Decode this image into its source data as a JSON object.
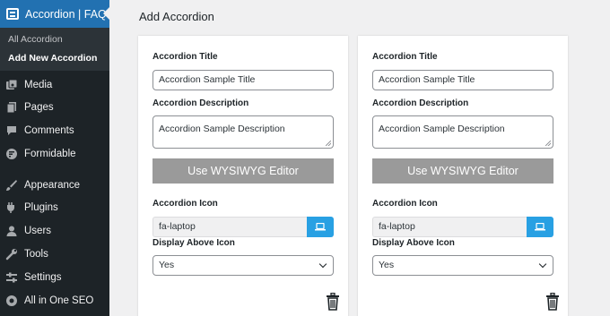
{
  "sidebar": {
    "active_menu": "Accordion | FAQ",
    "submenu": [
      {
        "label": "All Accordion"
      },
      {
        "label": "Add New Accordion"
      }
    ],
    "items": [
      {
        "label": "Media",
        "icon": "media-icon"
      },
      {
        "label": "Pages",
        "icon": "pages-icon"
      },
      {
        "label": "Comments",
        "icon": "comments-icon"
      },
      {
        "label": "Formidable",
        "icon": "formidable-icon"
      },
      {
        "label": "Appearance",
        "icon": "appearance-icon"
      },
      {
        "label": "Plugins",
        "icon": "plugins-icon"
      },
      {
        "label": "Users",
        "icon": "users-icon"
      },
      {
        "label": "Tools",
        "icon": "tools-icon"
      },
      {
        "label": "Settings",
        "icon": "settings-icon"
      },
      {
        "label": "All in One SEO",
        "icon": "seo-icon"
      }
    ]
  },
  "main": {
    "title": "Add Accordion",
    "cards": [
      {
        "title_label": "Accordion Title",
        "title_value": "Accordion Sample Title",
        "description_label": "Accordion Description",
        "description_value": "Accordion Sample Description",
        "wysiwyg_label": "Use WYSIWYG Editor",
        "icon_label": "Accordion Icon",
        "icon_value": "fa-laptop",
        "display_label": "Display Above Icon",
        "display_value": "Yes"
      },
      {
        "title_label": "Accordion Title",
        "title_value": "Accordion Sample Title",
        "description_label": "Accordion Description",
        "description_value": "Accordion Sample Description",
        "wysiwyg_label": "Use WYSIWYG Editor",
        "icon_label": "Accordion Icon",
        "icon_value": "fa-laptop",
        "display_label": "Display Above Icon",
        "display_value": "Yes"
      }
    ]
  },
  "colors": {
    "sidebar_bg": "#1d2327",
    "submenu_bg": "#2c3338",
    "active_blue": "#2271b1",
    "icon_button": "#28a0e3",
    "wysiwyg_button": "#9a9a9a",
    "page_bg": "#f0f0f1"
  }
}
